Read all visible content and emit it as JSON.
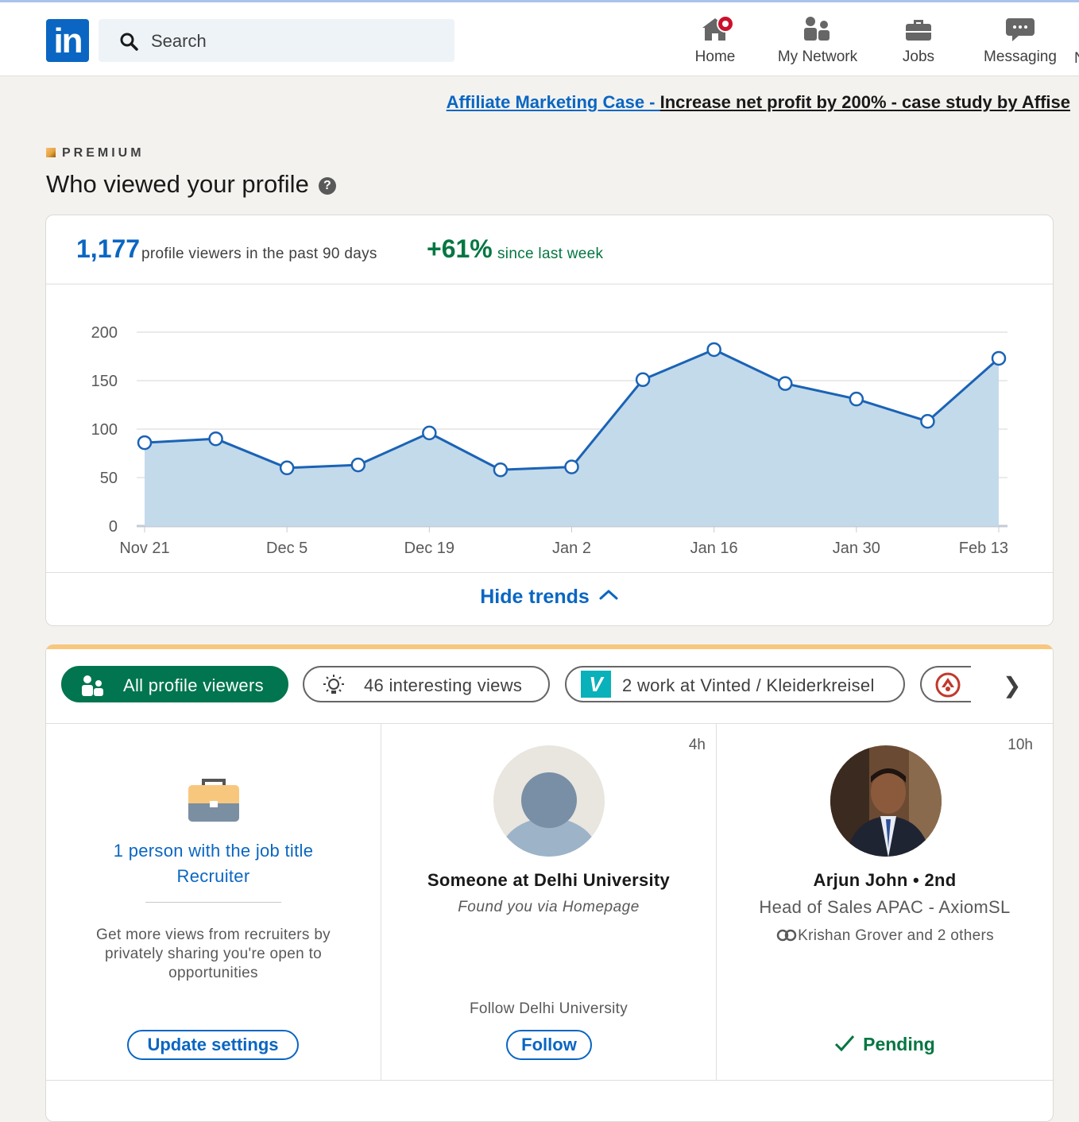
{
  "header": {
    "logo": "in",
    "search_placeholder": "Search",
    "nav": {
      "home": "Home",
      "network": "My Network",
      "jobs": "Jobs",
      "messaging": "Messaging",
      "edge_char": "N"
    }
  },
  "ad": {
    "link": "Affiliate Marketing Case - ",
    "text": "Increase net profit by 200% - case study by Affise"
  },
  "page": {
    "premium": "PREMIUM",
    "title": "Who viewed your profile",
    "help_icon": "?"
  },
  "stats": {
    "viewers": "1,177",
    "viewers_text": "profile viewers in the past 90 days",
    "change": "+61%",
    "change_text": "since last week"
  },
  "chart_data": {
    "type": "area",
    "x": [
      "Nov 21",
      "Nov 28",
      "Dec 5",
      "Dec 12",
      "Dec 19",
      "Dec 26",
      "Jan 2",
      "Jan 9",
      "Jan 16",
      "Jan 23",
      "Jan 30",
      "Feb 6",
      "Feb 13"
    ],
    "x_tick_labels": [
      "Nov 21",
      "Dec 5",
      "Dec 19",
      "Jan 2",
      "Jan 16",
      "Jan 30",
      "Feb 13"
    ],
    "values": [
      86,
      90,
      60,
      63,
      96,
      58,
      61,
      151,
      182,
      147,
      131,
      108,
      173
    ],
    "y_ticks": [
      "200",
      "150",
      "100",
      "50",
      "0"
    ],
    "ylim": [
      0,
      200
    ],
    "colors": {
      "line": "#1b63b5",
      "fill": "#c3daea",
      "grid": "#d6d6d6"
    }
  },
  "trends": {
    "label": "Hide trends"
  },
  "filters": {
    "all": "All profile viewers",
    "interesting": "46 interesting views",
    "vinted": "2 work at Vinted / Kleiderkreisel",
    "vinted_logo": "V"
  },
  "viewers": {
    "recruiter": {
      "line1": "1 person with the job title",
      "line2": "Recruiter",
      "desc": "Get more views from recruiters by privately sharing you're open to opportunities",
      "button": "Update settings"
    },
    "anon": {
      "time": "4h",
      "name": "Someone at Delhi University",
      "via": "Found you via Homepage",
      "follow_text": "Follow Delhi University",
      "button": "Follow"
    },
    "arjun": {
      "time": "10h",
      "name": "Arjun John • 2nd",
      "headline": "Head of Sales APAC - AxiomSL",
      "mutual": "Krishan Grover and 2 others",
      "status": "Pending"
    }
  }
}
